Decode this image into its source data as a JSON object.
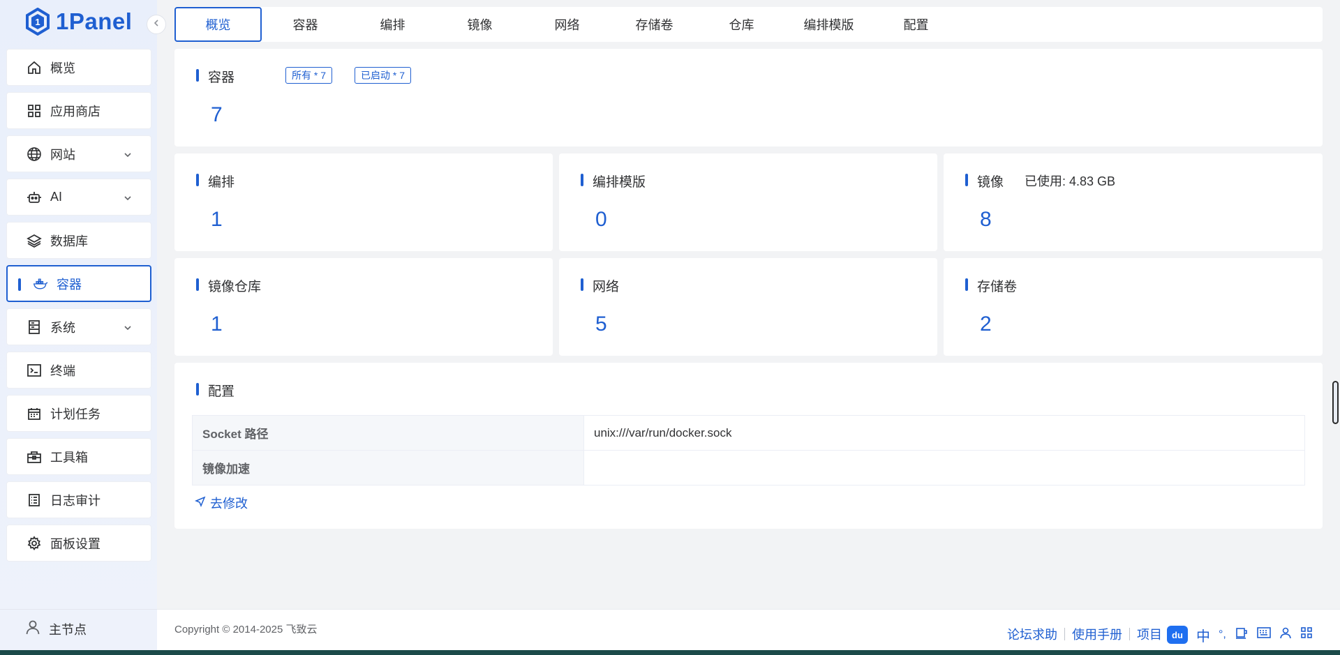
{
  "app": {
    "logo_text": "1Panel"
  },
  "sidebar": {
    "items": [
      {
        "label": "概览",
        "icon": "home-icon",
        "expandable": false
      },
      {
        "label": "应用商店",
        "icon": "grid-icon",
        "expandable": false
      },
      {
        "label": "网站",
        "icon": "globe-icon",
        "expandable": true
      },
      {
        "label": "AI",
        "icon": "robot-icon",
        "expandable": true
      },
      {
        "label": "数据库",
        "icon": "layers-icon",
        "expandable": false
      },
      {
        "label": "容器",
        "icon": "docker-icon",
        "expandable": false,
        "active": true
      },
      {
        "label": "系统",
        "icon": "server-icon",
        "expandable": true
      },
      {
        "label": "终端",
        "icon": "terminal-icon",
        "expandable": false
      },
      {
        "label": "计划任务",
        "icon": "calendar-icon",
        "expandable": false
      },
      {
        "label": "工具箱",
        "icon": "toolbox-icon",
        "expandable": false
      },
      {
        "label": "日志审计",
        "icon": "log-icon",
        "expandable": false
      },
      {
        "label": "面板设置",
        "icon": "gear-icon",
        "expandable": false
      }
    ],
    "node_label": "主节点"
  },
  "tabs": [
    "概览",
    "容器",
    "编排",
    "镜像",
    "网络",
    "存储卷",
    "仓库",
    "编排模版",
    "配置"
  ],
  "active_tab": 0,
  "containers_card": {
    "title": "容器",
    "tag_all": "所有 * 7",
    "tag_running": "已启动 * 7",
    "value": "7"
  },
  "stats": {
    "compose": {
      "title": "编排",
      "value": "1"
    },
    "compose_template": {
      "title": "编排模版",
      "value": "0"
    },
    "image": {
      "title": "镜像",
      "used_label": "已使用: 4.83 GB",
      "value": "8"
    },
    "registry": {
      "title": "镜像仓库",
      "value": "1"
    },
    "network": {
      "title": "网络",
      "value": "5"
    },
    "volume": {
      "title": "存储卷",
      "value": "2"
    }
  },
  "config": {
    "title": "配置",
    "rows": [
      {
        "key": "Socket 路径",
        "value": "unix:///var/run/docker.sock"
      },
      {
        "key": "镜像加速",
        "value": ""
      }
    ],
    "edit_link": "去修改"
  },
  "footer": {
    "copyright": "Copyright © 2014-2025 飞致云",
    "links": [
      "论坛求助",
      "使用手册",
      "项目"
    ]
  },
  "ime": {
    "badge": "du",
    "lang": "中",
    "punct": "°,"
  },
  "colors": {
    "accent": "#1f5fd1",
    "bg": "#f2f3f5"
  }
}
